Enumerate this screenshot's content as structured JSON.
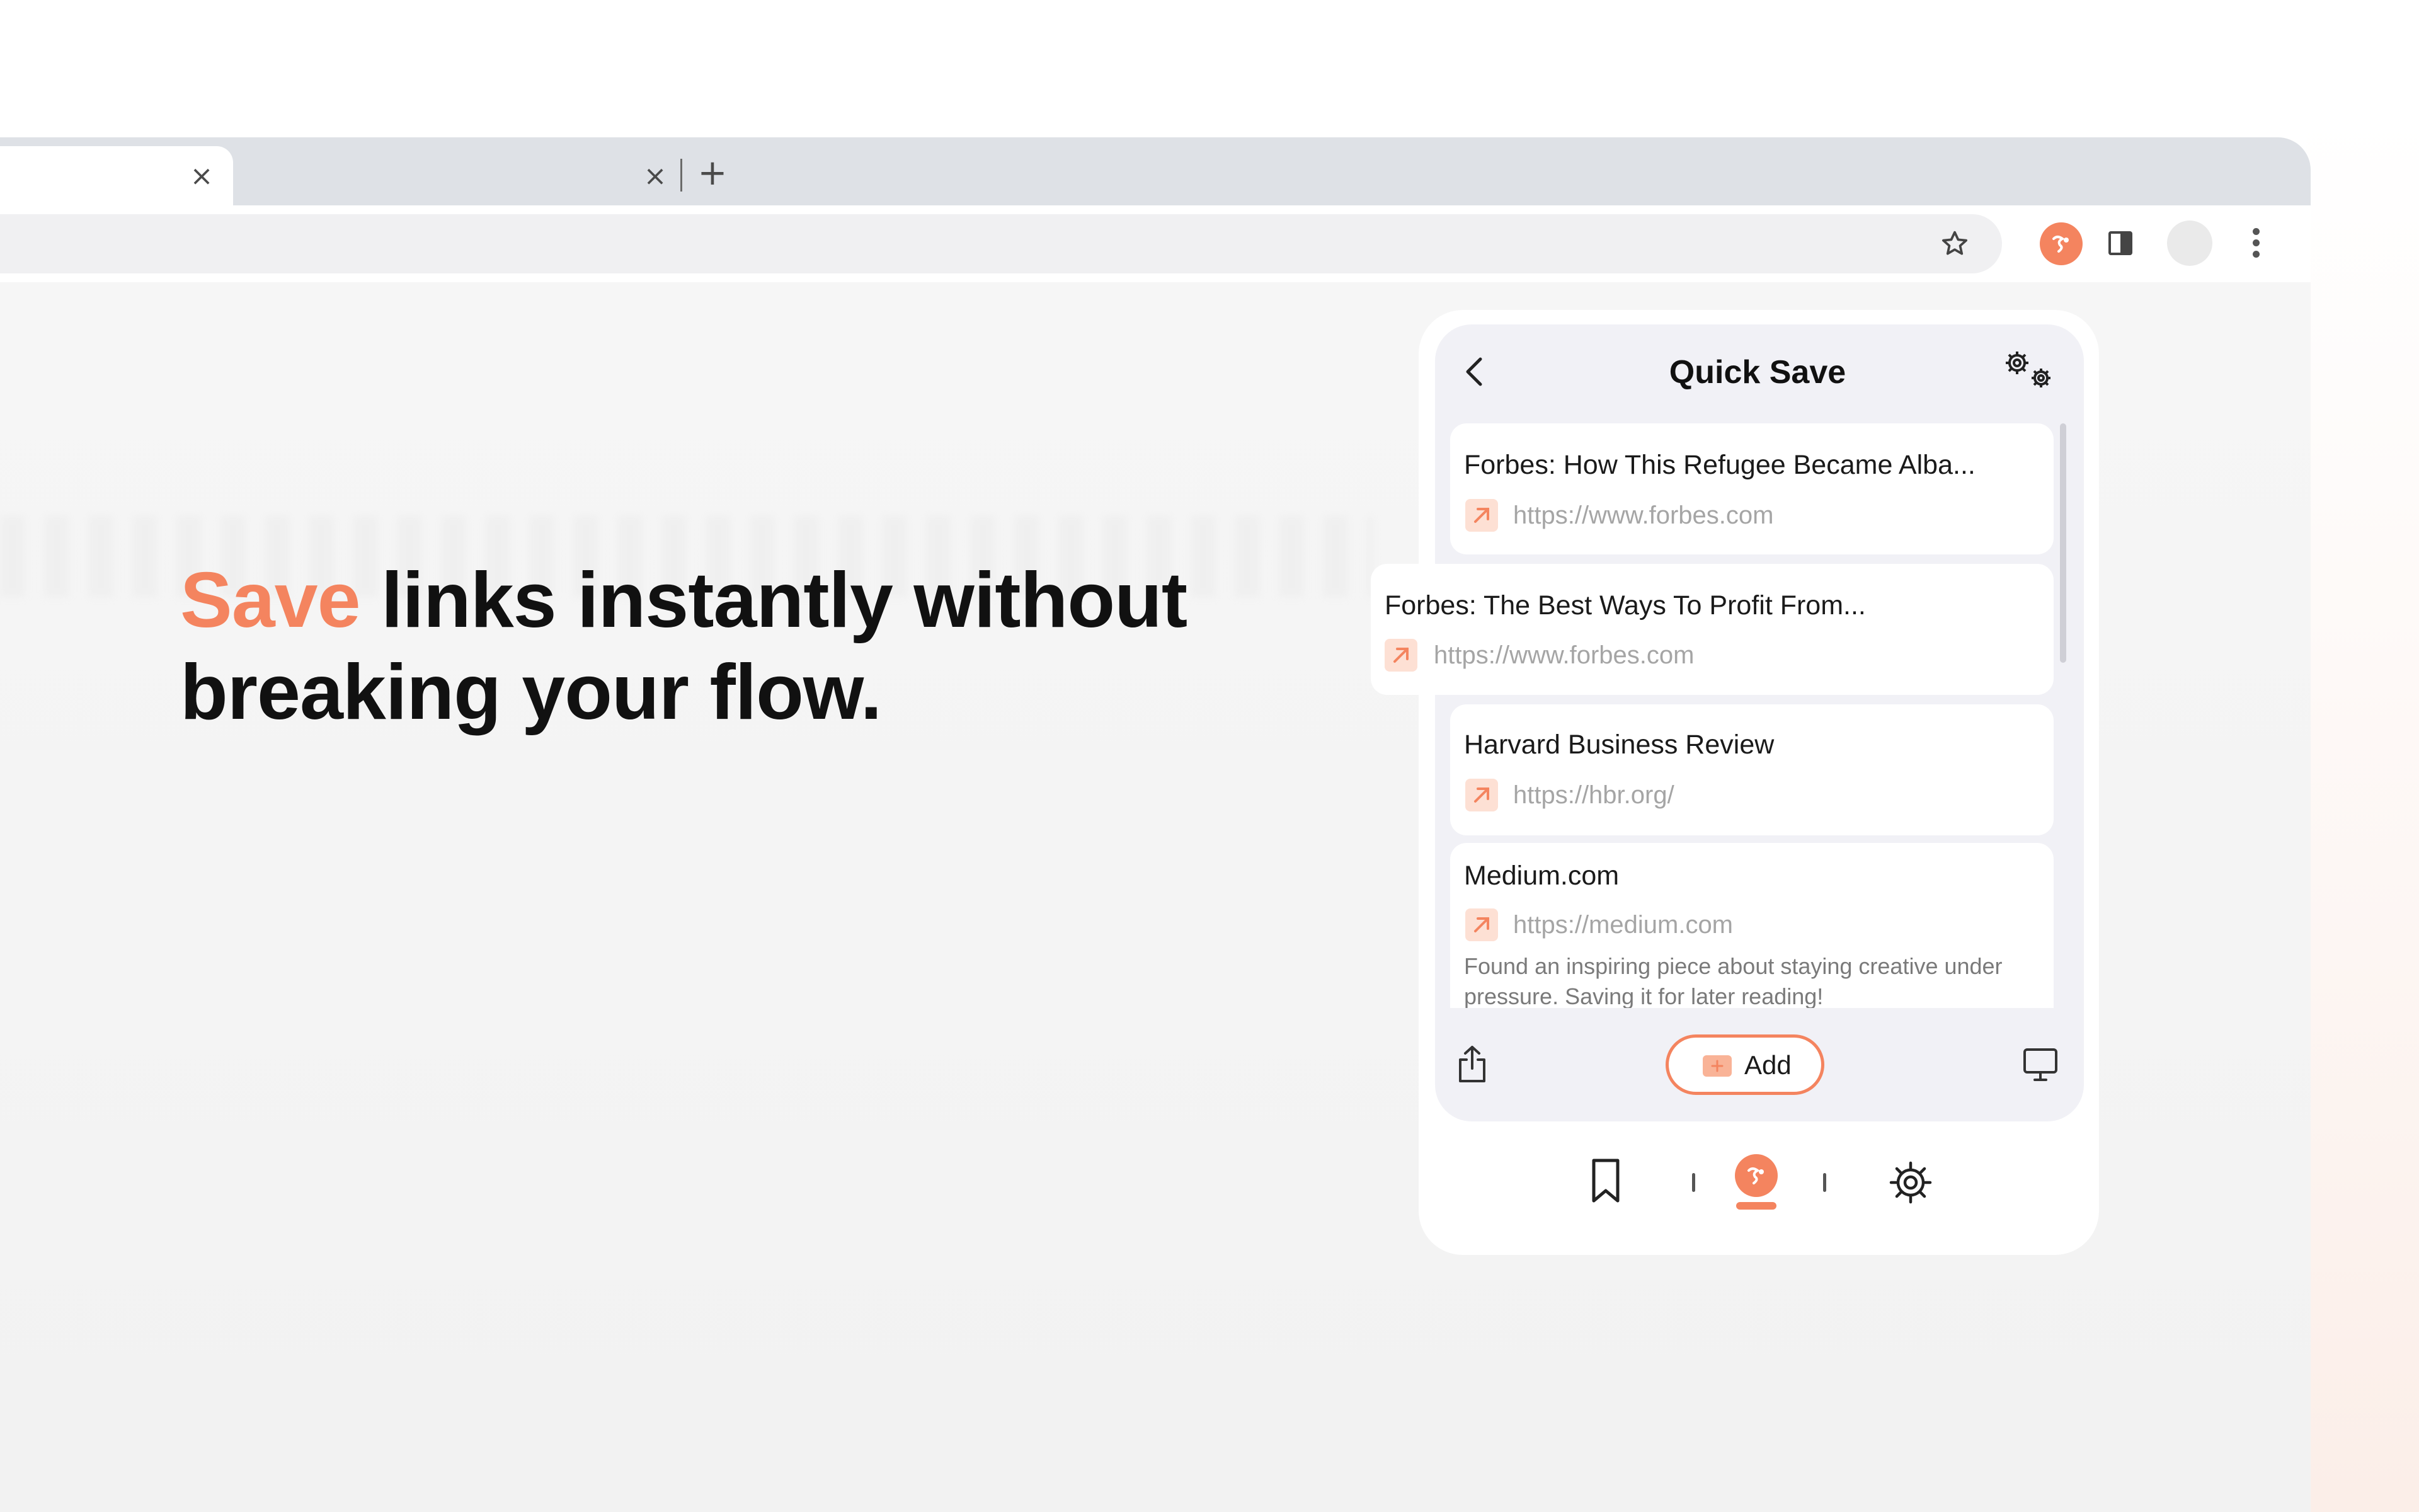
{
  "headline": {
    "accent_word": "Save",
    "rest_line1": " links instantly without",
    "line2": "breaking your flow."
  },
  "browser": {
    "tabs": [
      {
        "title": "",
        "active": true,
        "close_icon": "×"
      },
      {
        "title": "",
        "active": false,
        "close_icon": "×"
      }
    ],
    "new_tab_icon": "+",
    "omnibox": {
      "value": ""
    },
    "toolbar_icons": [
      "star-icon",
      "extension-icon",
      "side-panel-icon",
      "profile-avatar",
      "kebab-menu-icon"
    ]
  },
  "popup": {
    "title": "Quick Save",
    "items": [
      {
        "title": "Forbes: How This Refugee Became Alba...",
        "url": "https://www.forbes.com",
        "note": ""
      },
      {
        "title": "Forbes: The Best Ways To Profit From...",
        "url": "https://www.forbes.com",
        "note": ""
      },
      {
        "title": "Harvard Business Review",
        "url": "https://hbr.org/",
        "note": ""
      },
      {
        "title": "Medium.com",
        "url": "https://medium.com",
        "note": "Found an inspiring piece about staying creative under pressure. Saving it for later reading!"
      }
    ],
    "add_label": "Add",
    "footer_icons": [
      "share-icon",
      "monitor-icon"
    ],
    "nav_icons": [
      "bookmark-icon",
      "home-logo-icon",
      "settings-icon"
    ]
  },
  "colors": {
    "accent": "#f4845f",
    "accent_light": "#fde0d4",
    "text_dark": "#111111",
    "url_gray": "#a5a5a5",
    "panel_bg": "#f1f1f6"
  }
}
